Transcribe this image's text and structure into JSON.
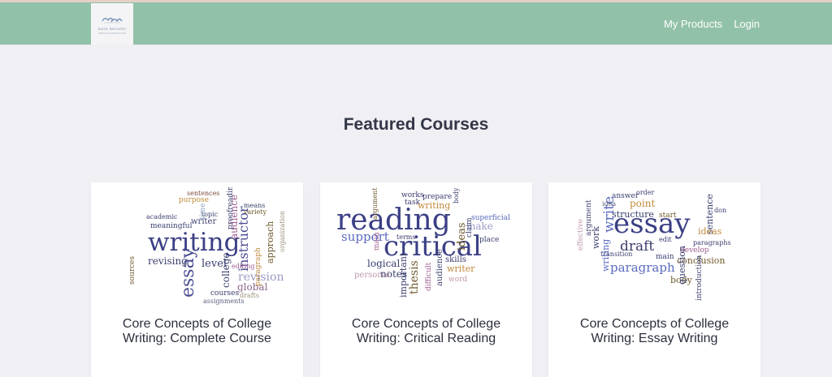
{
  "header": {
    "logo": {
      "name": "KATE BRONEY",
      "tagline": "WRITING INSTRUCTION"
    },
    "nav": [
      {
        "label": "My Products"
      },
      {
        "label": "Login"
      }
    ]
  },
  "main": {
    "section_title": "Featured Courses",
    "courses": [
      {
        "title": "Core Concepts of College Writing: Complete Course",
        "image_words": [
          "sentences",
          "purpose",
          "writer",
          "meaningful",
          "academic",
          "topic",
          "writing",
          "essay",
          "revising",
          "level",
          "instructor",
          "audience",
          "revision",
          "approach",
          "college",
          "global",
          "drafts",
          "courses",
          "assignments",
          "editing",
          "proofreading",
          "means",
          "variety",
          "organization",
          "time",
          "sources",
          "paragraph"
        ]
      },
      {
        "title": "Core Concepts of College Writing: Critical Reading",
        "image_words": [
          "works",
          "prepare",
          "task",
          "writing",
          "reading",
          "critical",
          "support",
          "logical",
          "thesis",
          "important",
          "difficult",
          "ideas",
          "make",
          "superficial",
          "place",
          "notes",
          "personal",
          "skills",
          "writer",
          "audience",
          "terms",
          "argument",
          "main",
          "word",
          "claim",
          "body"
        ]
      },
      {
        "title": "Core Concepts of College Writing: Essay Writing",
        "image_words": [
          "answer",
          "order",
          "point",
          "write",
          "essay",
          "structure",
          "draft",
          "paragraph",
          "start",
          "edit",
          "main",
          "develop",
          "conclusion",
          "body",
          "sentence",
          "don",
          "ideas",
          "paragraphs",
          "introduction",
          "question",
          "idea",
          "transition",
          "work",
          "argument",
          "effective",
          "writing"
        ]
      }
    ]
  }
}
